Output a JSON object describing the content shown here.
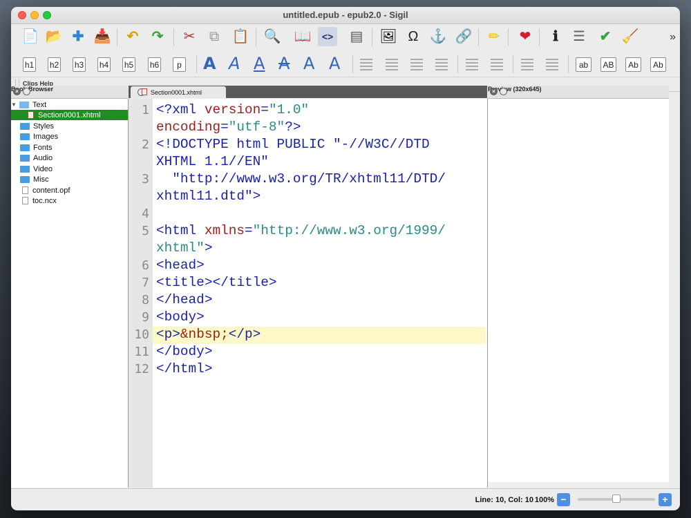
{
  "window": {
    "title": "untitled.epub - epub2.0 - Sigil"
  },
  "toolbar_main": {
    "buttons": [
      {
        "name": "new-file-icon",
        "glyph": "📄"
      },
      {
        "name": "open-file-icon",
        "glyph": "📂"
      },
      {
        "name": "add-file-icon",
        "glyph": "✚"
      },
      {
        "name": "save-icon",
        "glyph": "📥"
      },
      {
        "name": "undo-icon",
        "glyph": "↶"
      },
      {
        "name": "redo-icon",
        "glyph": "↷"
      },
      {
        "name": "cut-icon",
        "glyph": "✂"
      },
      {
        "name": "copy-icon",
        "glyph": "⧉"
      },
      {
        "name": "paste-icon",
        "glyph": "📋"
      },
      {
        "name": "find-icon",
        "glyph": "🔍"
      },
      {
        "name": "book-view-icon",
        "glyph": "📖"
      },
      {
        "name": "code-view-icon",
        "glyph": "<>"
      },
      {
        "name": "split-view-icon",
        "glyph": "▤"
      },
      {
        "name": "insert-image-icon",
        "glyph": "🖼"
      },
      {
        "name": "special-character-icon",
        "glyph": "Ω"
      },
      {
        "name": "anchor-icon",
        "glyph": "⚓"
      },
      {
        "name": "link-icon",
        "glyph": "🔗"
      },
      {
        "name": "pencil-icon",
        "glyph": "✏"
      },
      {
        "name": "heart-icon",
        "glyph": "❤"
      },
      {
        "name": "info-icon",
        "glyph": "ℹ"
      },
      {
        "name": "toc-icon",
        "glyph": "☰"
      },
      {
        "name": "spellcheck-icon",
        "glyph": "✔"
      },
      {
        "name": "clean-icon",
        "glyph": "🧹"
      }
    ],
    "more": "»"
  },
  "toolbar_format": {
    "headings": [
      "h1",
      "h2",
      "h3",
      "h4",
      "h5",
      "h6",
      "p"
    ],
    "text_style": [
      "A",
      "A",
      "A",
      "A",
      "A",
      "A"
    ],
    "case": [
      "ab",
      "AB",
      "Ab",
      "Ab"
    ]
  },
  "clips": {
    "label": "Clips Help"
  },
  "book_browser": {
    "title": "Book Browser",
    "folders": [
      {
        "label": "Text",
        "open": true
      },
      {
        "label": "Section0001.xhtml",
        "file": true,
        "selected": true
      },
      {
        "label": "Styles"
      },
      {
        "label": "Images"
      },
      {
        "label": "Fonts"
      },
      {
        "label": "Audio"
      },
      {
        "label": "Video"
      },
      {
        "label": "Misc"
      },
      {
        "label": "content.opf",
        "file": true
      },
      {
        "label": "toc.ncx",
        "file": true
      }
    ]
  },
  "editor": {
    "tab_label": "Section0001.xhtml",
    "line_numbers": [
      "1",
      "2",
      "3",
      "4",
      "5",
      "6",
      "7",
      "8",
      "9",
      "10",
      "11",
      "12"
    ],
    "current_line": 10,
    "colors": {
      "tag": "#1a23a8",
      "attr": "#9c1d1d",
      "string": "#2b8a8a",
      "highlight": "#fdf9c6"
    }
  },
  "preview": {
    "title": "Preview (320x645)"
  },
  "status": {
    "position": "Line: 10, Col: 10",
    "zoom": "100%",
    "zoom_out": "−",
    "zoom_in": "+"
  }
}
